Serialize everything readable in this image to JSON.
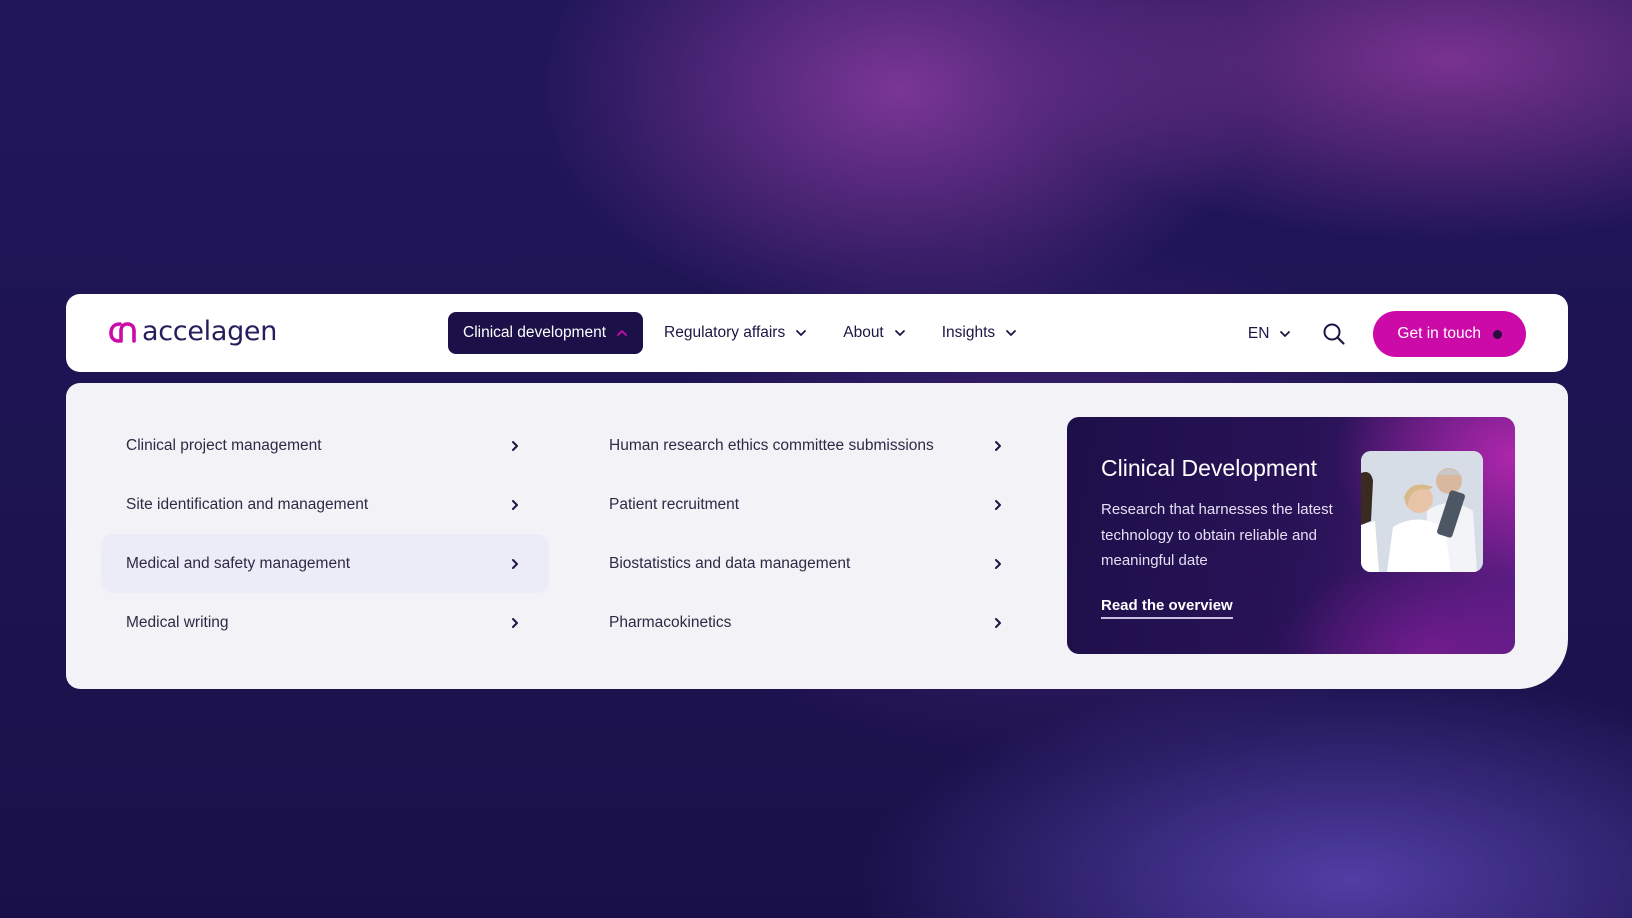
{
  "brand": {
    "name": "accelagen",
    "logo_icon": "accelagen-logo-mark",
    "accent_color": "#cc0aa8",
    "dark_color": "#1b1048"
  },
  "nav": {
    "items": [
      {
        "label": "Clinical development",
        "active": true
      },
      {
        "label": "Regulatory affairs",
        "active": false
      },
      {
        "label": "About",
        "active": false
      },
      {
        "label": "Insights",
        "active": false
      }
    ],
    "language": "EN",
    "search_icon": "search-icon",
    "cta_label": "Get in touch"
  },
  "dropdown": {
    "column1": [
      {
        "label": "Clinical project management"
      },
      {
        "label": "Site identification and management"
      },
      {
        "label": "Medical and safety management",
        "highlighted": true
      },
      {
        "label": "Medical writing"
      }
    ],
    "column2": [
      {
        "label": "Human research ethics committee submissions"
      },
      {
        "label": "Patient recruitment"
      },
      {
        "label": "Biostatistics and data management"
      },
      {
        "label": "Pharmacokinetics"
      }
    ],
    "feature": {
      "title": "Clinical Development",
      "description": "Research that harnesses the latest technology to obtain reliable and meaningful date",
      "link_label": "Read the overview",
      "image": "scientists-with-tablet-photo"
    }
  }
}
